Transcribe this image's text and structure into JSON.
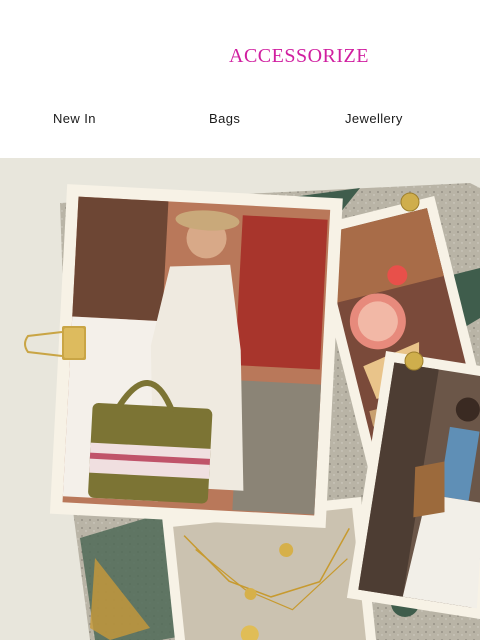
{
  "brand": {
    "logo_text": "ACCESSORIZE",
    "color": "#d01fa0"
  },
  "nav": {
    "items": [
      {
        "label": "New In"
      },
      {
        "label": "Bags"
      },
      {
        "label": "Jewellery"
      }
    ]
  },
  "hero": {
    "background": "#e8e6dc",
    "images": [
      {
        "name": "woman-with-tote-bag-photo"
      },
      {
        "name": "picnic-basket-watermelon-photo"
      },
      {
        "name": "woman-with-fringe-bag-photo"
      },
      {
        "name": "gold-charm-necklaces-photo"
      }
    ],
    "decorations": [
      "binder-clip-icon",
      "gold-pin-icon"
    ]
  }
}
